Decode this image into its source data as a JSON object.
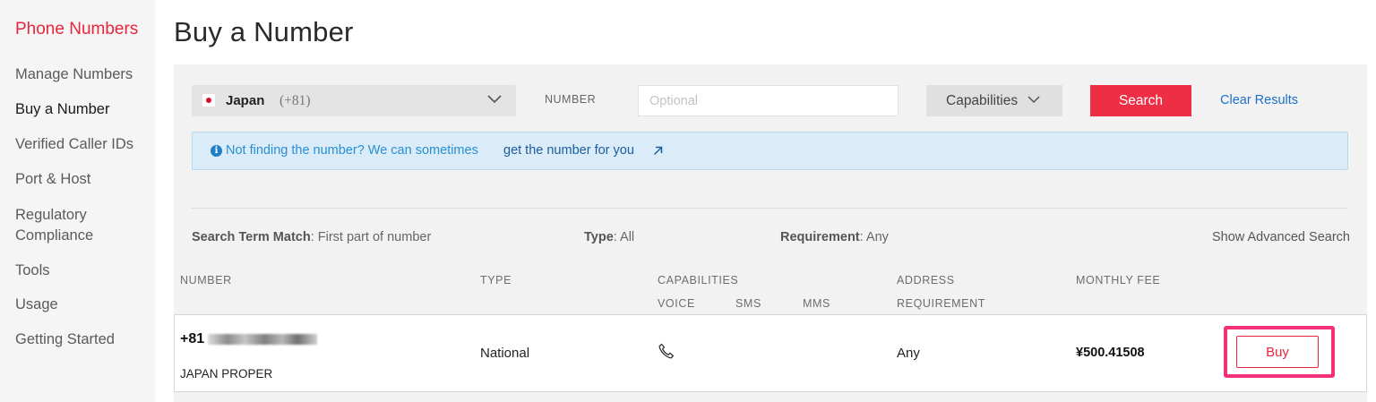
{
  "sidebar": {
    "heading": "Phone Numbers",
    "items": [
      {
        "label": "Manage Numbers"
      },
      {
        "label": "Buy a Number"
      },
      {
        "label": "Verified Caller IDs"
      },
      {
        "label": "Port & Host"
      },
      {
        "label": "Regulatory"
      },
      {
        "label": "Compliance"
      },
      {
        "label": "Tools"
      },
      {
        "label": "Usage"
      },
      {
        "label": "Getting Started"
      }
    ],
    "active": "Buy a Number"
  },
  "page": {
    "title": "Buy a Number"
  },
  "search": {
    "country": "Japan",
    "country_code": "(+81)",
    "number_label": "NUMBER",
    "number_placeholder": "Optional",
    "capabilities_label": "Capabilities",
    "search_label": "Search",
    "clear_label": "Clear Results"
  },
  "banner": {
    "text": "Not finding the number? We can sometimes",
    "link": "get the number for you",
    "icon": "info-icon"
  },
  "filters": {
    "match_label": "Search Term Match",
    "match_value": ": First part of number",
    "type_label": "Type",
    "type_value": ": All",
    "requirement_label": "Requirement",
    "requirement_value": ": Any",
    "advanced_label": "Show Advanced Search"
  },
  "table": {
    "headers": {
      "number": "NUMBER",
      "type": "TYPE",
      "capabilities": "CAPABILITIES",
      "voice": "VOICE",
      "sms": "SMS",
      "mms": "MMS",
      "address": "ADDRESS",
      "requirement": "REQUIREMENT",
      "fee": "MONTHLY FEE"
    },
    "rows": [
      {
        "number_prefix": "+81",
        "region": "JAPAN PROPER",
        "type": "National",
        "voice_icon": "phone-icon",
        "address_requirement": "Any",
        "monthly_fee": "¥500.41508",
        "buy_label": "Buy"
      }
    ]
  },
  "colors": {
    "brand": "#e8253c",
    "link": "#1f6fc5",
    "highlight": "#f23178",
    "banner_bg": "#d9ecf7"
  }
}
